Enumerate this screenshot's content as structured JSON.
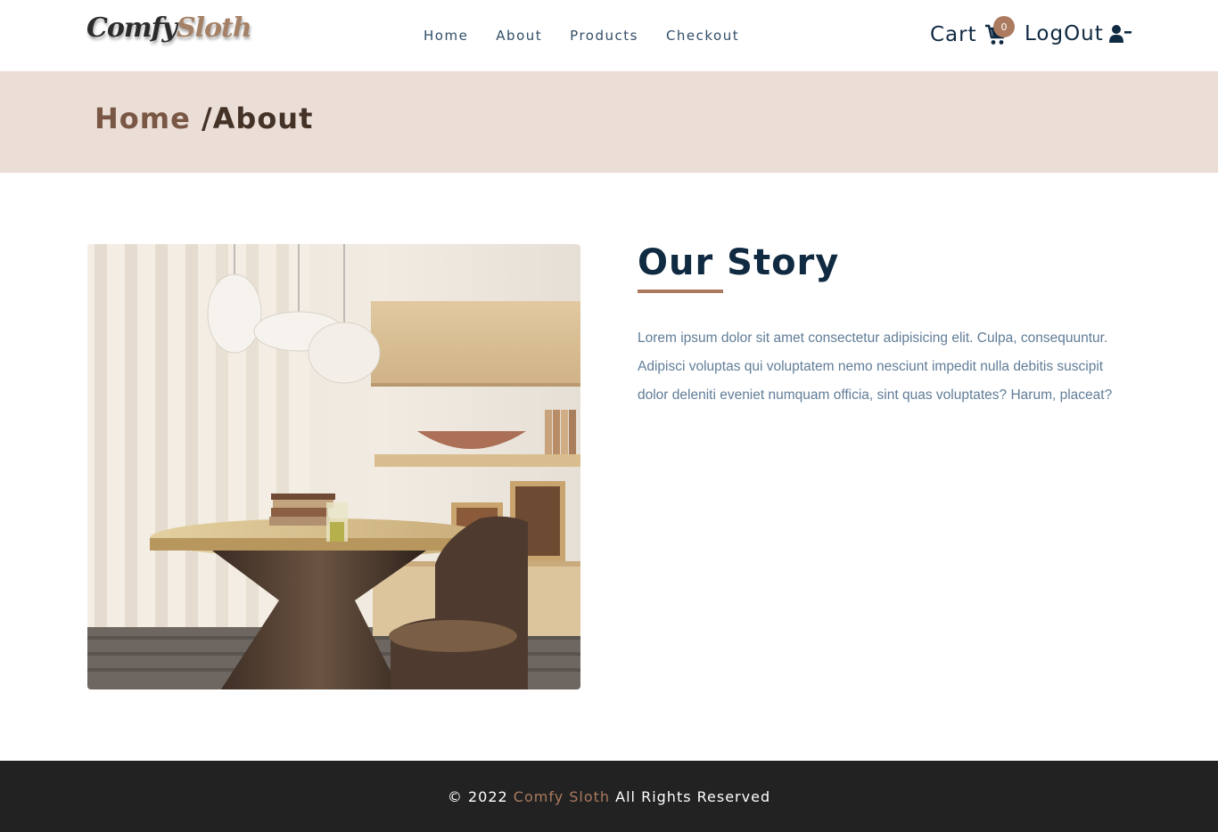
{
  "navbar": {
    "logo": {
      "part1": "Comfy",
      "part2": "Sloth"
    },
    "links": [
      {
        "label": "Home"
      },
      {
        "label": "About"
      },
      {
        "label": "Products"
      },
      {
        "label": "Checkout"
      }
    ],
    "cart": {
      "label": "Cart",
      "count": "0",
      "icon": "shopping-cart-icon"
    },
    "logout": {
      "label": "LogOut",
      "icon": "user-minus-icon"
    }
  },
  "hero": {
    "breadcrumb_home": "Home",
    "breadcrumb_separator": "/",
    "breadcrumb_current": "About"
  },
  "story": {
    "title": "Our Story",
    "body": "Lorem ipsum dolor sit amet consectetur adipisicing elit. Culpa, consequuntur. Adipisci voluptas qui voluptatem nemo nesciunt impedit nulla debitis suscipit dolor deleniti eveniet numquam officia, sint quas voluptates? Harum, placeat?"
  },
  "footer": {
    "prefix": "© 2022",
    "brand": "Comfy Sloth",
    "suffix": "All Rights Reserved"
  },
  "colors": {
    "accent": "#ab7a5f",
    "hero_bg": "#eaded7",
    "heading": "#102a42",
    "footer_bg": "#222222"
  }
}
